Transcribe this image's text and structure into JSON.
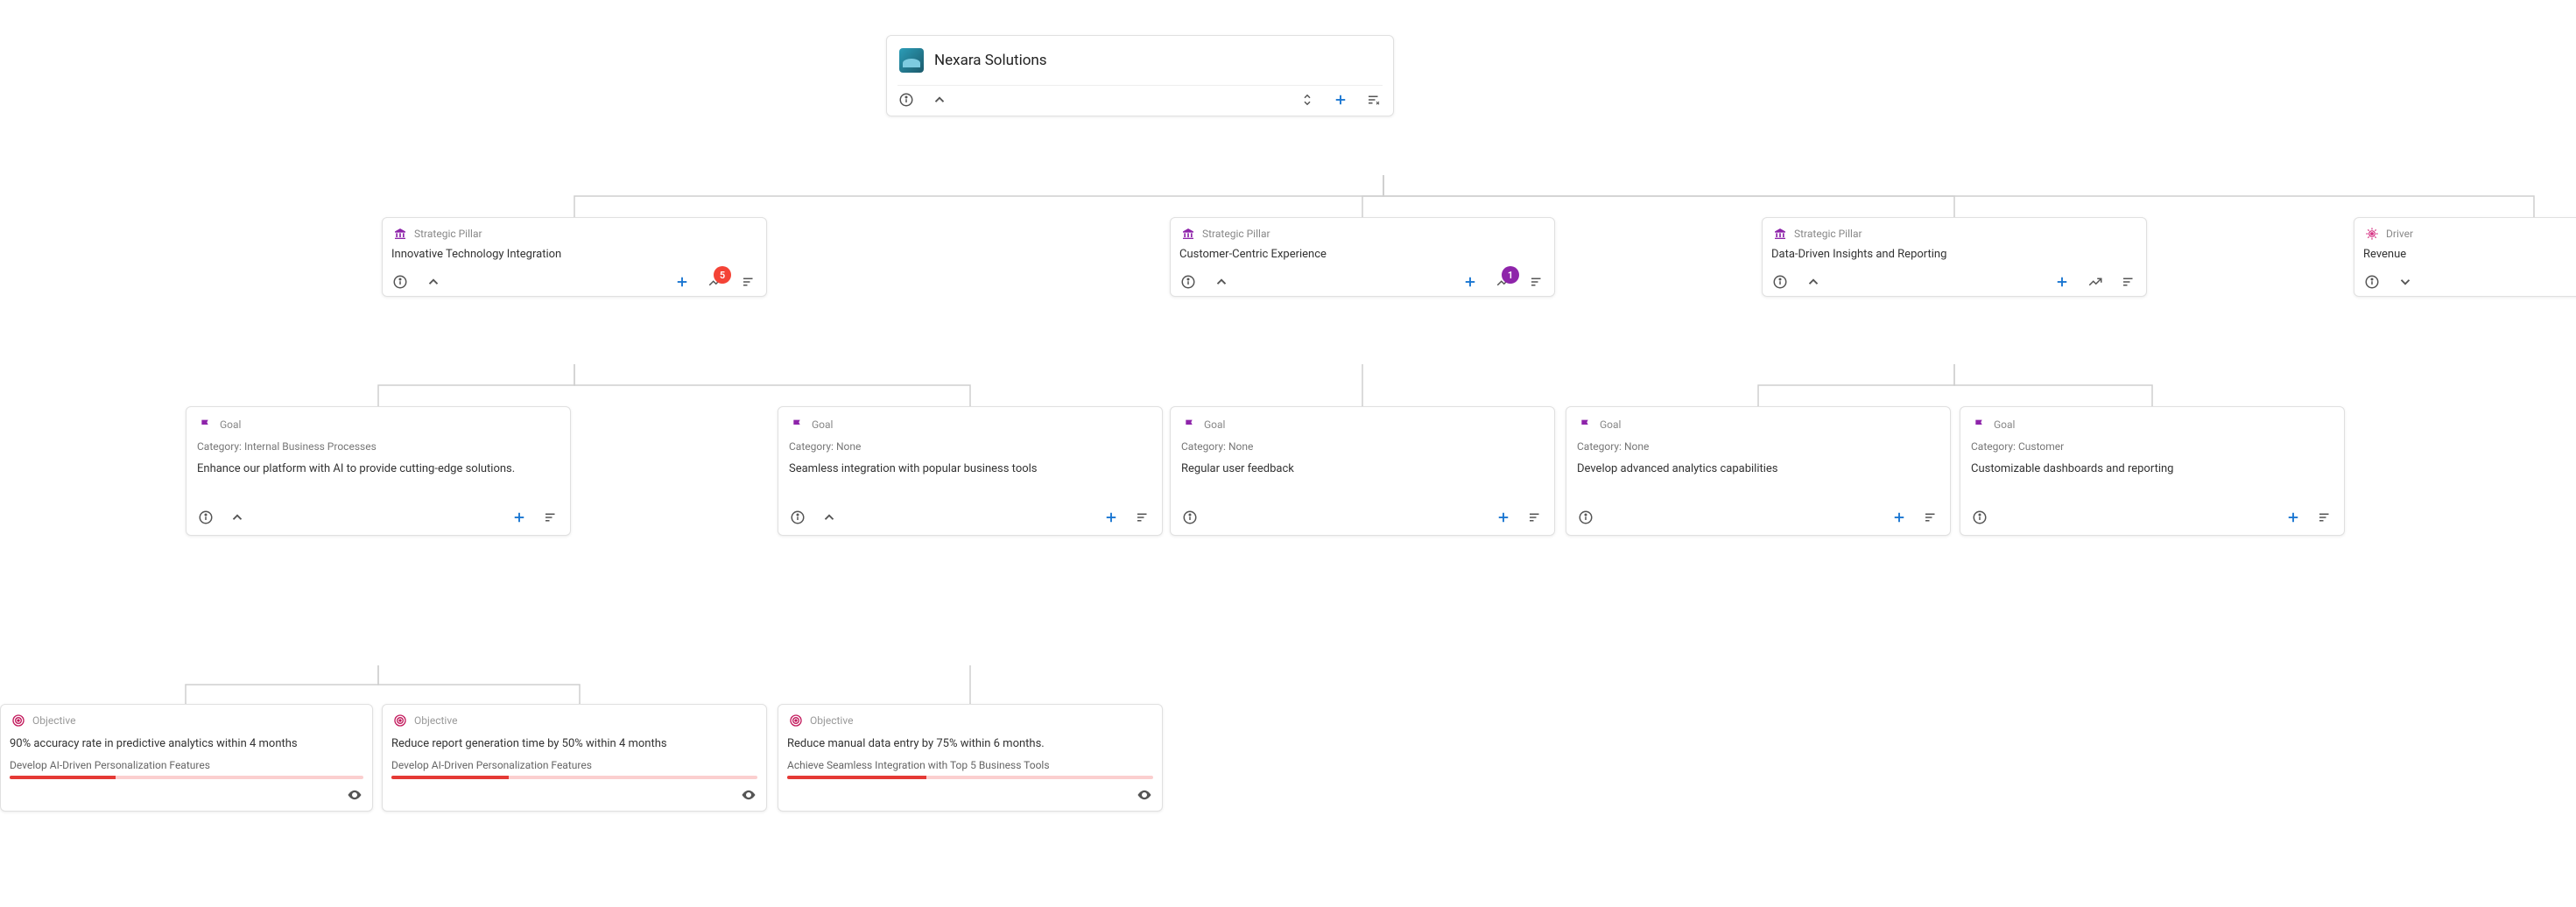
{
  "root": {
    "title": "Nexara Solutions"
  },
  "types": {
    "pillar": "Strategic Pillar",
    "driver": "Driver",
    "goal": "Goal",
    "objective": "Objective"
  },
  "category_prefix": "Category: ",
  "pillars": [
    {
      "title": "Innovative Technology Integration",
      "badge": "5",
      "badge_color": "red"
    },
    {
      "title": "Customer-Centric Experience",
      "badge": "1",
      "badge_color": "purple"
    },
    {
      "title": "Data-Driven Insights and Reporting"
    }
  ],
  "driver": {
    "title": "Revenue"
  },
  "goals": [
    {
      "category": "Internal Business Processes",
      "text": "Enhance our platform with AI to provide cutting-edge solutions.",
      "has_caret": true
    },
    {
      "category": "None",
      "text": "Seamless integration with popular business tools",
      "has_caret": true
    },
    {
      "category": "None",
      "text": "Regular user feedback",
      "has_caret": false
    },
    {
      "category": "None",
      "text": "Develop advanced analytics capabilities",
      "has_caret": false
    },
    {
      "category": "Customer",
      "text": "Customizable dashboards and reporting",
      "has_caret": false
    }
  ],
  "objectives": [
    {
      "title": "90% accuracy rate in predictive analytics within 4 months",
      "sub": "Develop AI-Driven Personalization Features",
      "progress": 30
    },
    {
      "title": "Reduce report generation time by 50% within 4 months",
      "sub": "Develop AI-Driven Personalization Features",
      "progress": 32
    },
    {
      "title": "Reduce manual data entry by 75% within 6 months.",
      "sub": "Achieve Seamless Integration with Top 5 Business Tools",
      "progress": 38
    }
  ]
}
